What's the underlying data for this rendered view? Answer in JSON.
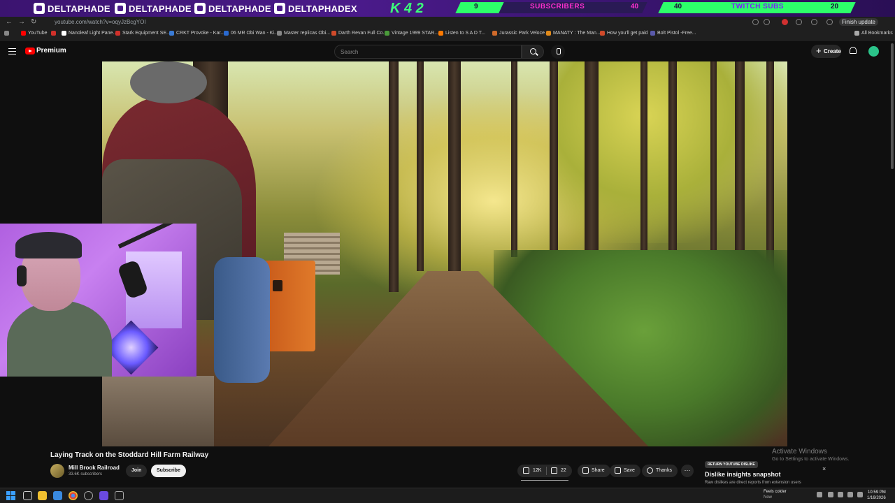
{
  "stream_overlay": {
    "handles": [
      "DELTAPHADE",
      "DELTAPHADE",
      "DELTAPHADE",
      "DELTAPHADEX"
    ],
    "counter": "K 4 2",
    "sub_goal_current": "9",
    "sub_goal_label": "SUBSCRIBERS",
    "sub_goal_target": "40",
    "twitch_goal_current": "40",
    "twitch_goal_label": "TWITCH SUBS",
    "twitch_goal_target": "20"
  },
  "browser": {
    "url": "youtube.com/watch?v=oqyJzBcgYOI",
    "update_label": "Finish update",
    "all_bookmarks": "All Bookmarks",
    "bookmarks": [
      {
        "label": "YouTube",
        "color": "#ff0000"
      },
      {
        "label": "Nanoleaf Light Pane...",
        "color": "#ffffff"
      },
      {
        "label": "Stark Equipment SE...",
        "color": "#d0302a"
      },
      {
        "label": "CRKT Provoke - Kar...",
        "color": "#3a7bd5"
      },
      {
        "label": "06 MR Obi Wan - Ki...",
        "color": "#2a6ad0"
      },
      {
        "label": "Master replicas Obi...",
        "color": "#888888"
      },
      {
        "label": "Darth Revan Full Co...",
        "color": "#d04a2a"
      },
      {
        "label": "Vintage 1999 STAR...",
        "color": "#4a9a3a"
      },
      {
        "label": "Listen to S A D T...",
        "color": "#ff7a00"
      },
      {
        "label": "Jurassic Park Veloce...",
        "color": "#d06a2a"
      },
      {
        "label": "MANATY : The Man...",
        "color": "#e08a1a"
      },
      {
        "label": "How you'll get paid",
        "color": "#d04a2a"
      },
      {
        "label": "Bolt Pistol -Free...",
        "color": "#5a5aaa"
      }
    ]
  },
  "youtube": {
    "brand": "Premium",
    "search_placeholder": "Search",
    "create_label": "Create",
    "video": {
      "title": "Laying Track on the Stoddard Hill Farm Railway",
      "channel": "Mill Brook Railroad",
      "subscribers": "33.6K subscribers",
      "join_label": "Join",
      "subscribe_label": "Subscribe",
      "likes": "12K",
      "dislikes": "22",
      "share_label": "Share",
      "save_label": "Save",
      "thanks_label": "Thanks",
      "more_label": "···"
    },
    "dislike_panel": {
      "tag": "RETURN YOUTUBE DISLIKE",
      "title": "Dislike insights snapshot",
      "subtitle": "Raw dislikes are direct reports from extension users",
      "close": "×"
    }
  },
  "windows": {
    "activate_title": "Activate Windows",
    "activate_sub": "Go to Settings to activate Windows.",
    "weather_title": "Feels colder",
    "weather_sub": "Now",
    "time": "10:59 PM",
    "date": "1/16/2026"
  },
  "colors": {
    "accent_green": "#2dff6a",
    "overlay_purple": "#4a1a8a",
    "youtube_red": "#ff0000"
  }
}
